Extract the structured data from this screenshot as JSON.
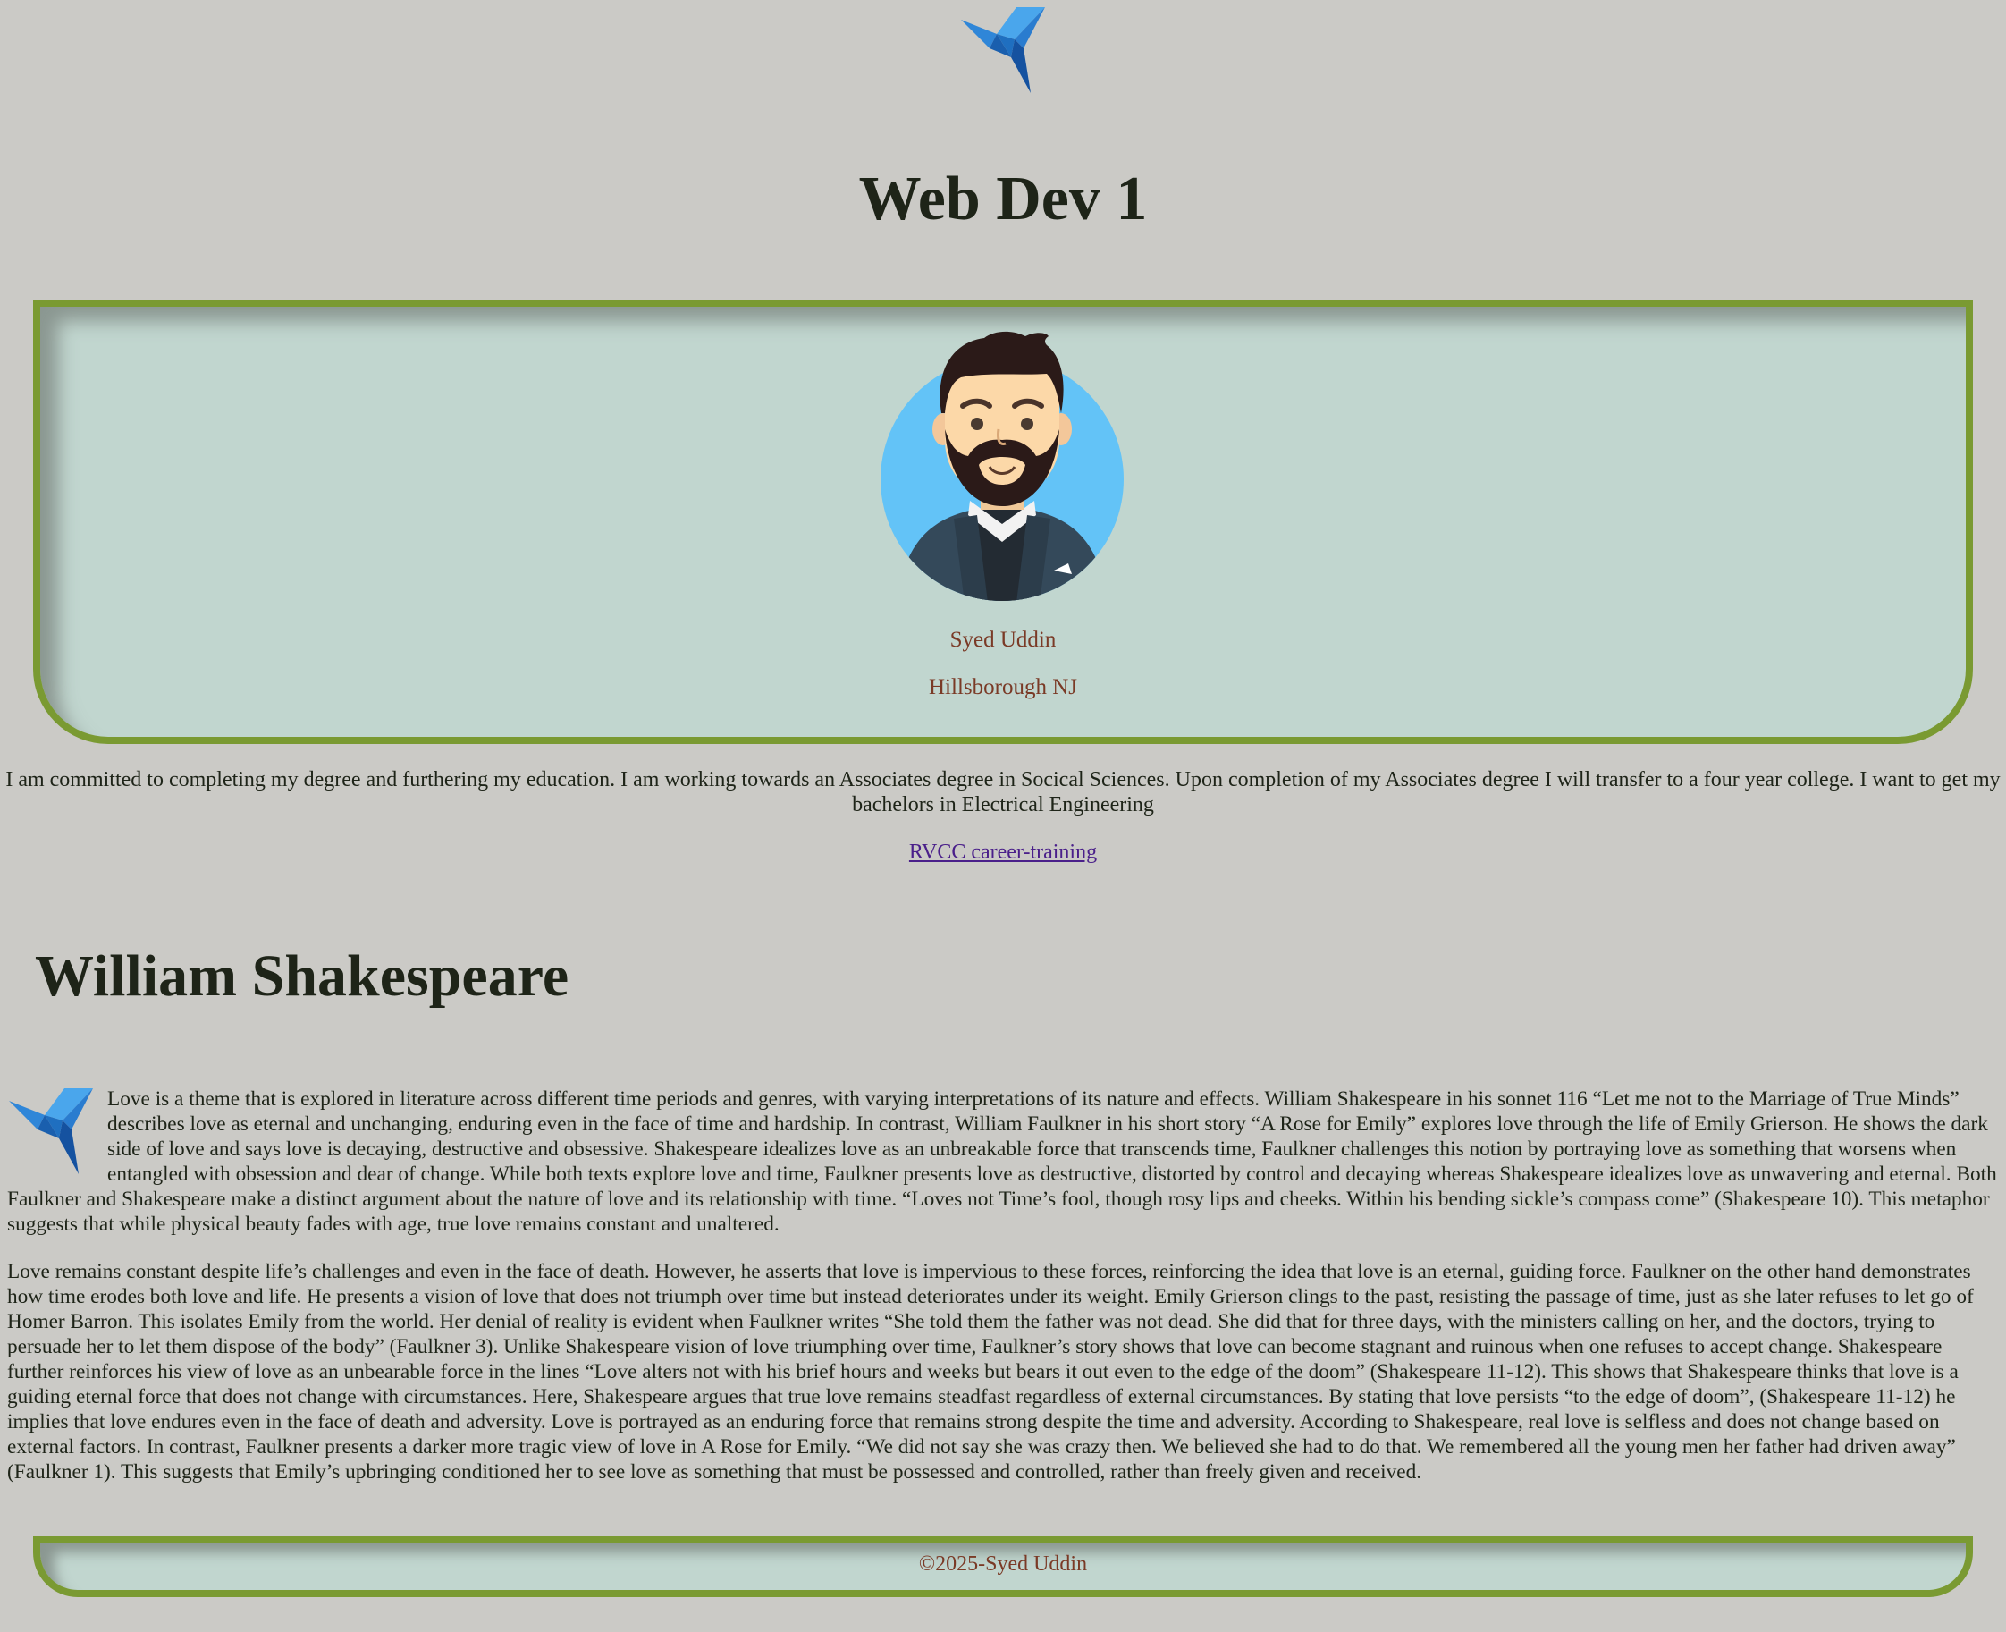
{
  "header": {
    "logo_icon": "origami-bird-icon",
    "title": "Web Dev 1"
  },
  "profile": {
    "avatar_icon": "bearded-man-avatar",
    "name": "Syed Uddin",
    "location": "Hillsborough NJ"
  },
  "intro": {
    "text": "I am committed to completing my degree and furthering my education. I am working towards an Associates degree in Socical Sciences. Upon completion of my Associates degree I will transfer to a four year college. I want to get my bachelors in Electrical Engineering",
    "link_label": "RVCC career-training"
  },
  "essay": {
    "title": "William Shakespeare",
    "paragraphs": [
      "Love is a theme that is explored in literature across different time periods and genres, with varying interpretations of its nature and effects. William Shakespeare in his sonnet 116 “Let me not to the Marriage of True Minds” describes love as eternal and unchanging, enduring even in the face of time and hardship. In contrast, William Faulkner in his short story “A Rose for Emily” explores love through the life of Emily Grierson. He shows the dark side of love and says love is decaying, destructive and obsessive. Shakespeare idealizes love as an unbreakable force that transcends time, Faulkner challenges this notion by portraying love as something that worsens when entangled with obsession and dear of change. While both texts explore love and time, Faulkner presents love as destructive, distorted by control and decaying whereas Shakespeare idealizes love as unwavering and eternal. Both Faulkner and Shakespeare make a distinct argument about the nature of love and its relationship with time. “Loves not Time’s fool, though rosy lips and cheeks. Within his bending sickle’s compass come” (Shakespeare 10). This metaphor suggests that while physical beauty fades with age, true love remains constant and unaltered.",
      "Love remains constant despite life’s challenges and even in the face of death. However, he asserts that love is impervious to these forces, reinforcing the idea that love is an eternal, guiding force. Faulkner on the other hand demonstrates how time erodes both love and life. He presents a vision of love that does not triumph over time but instead deteriorates under its weight. Emily Grierson clings to the past, resisting the passage of time, just as she later refuses to let go of Homer Barron. This isolates Emily from the world. Her denial of reality is evident when Faulkner writes “She told them the father was not dead. She did that for three days, with the ministers calling on her, and the doctors, trying to persuade her to let them dispose of the body” (Faulkner 3). Unlike Shakespeare vision of love triumphing over time, Faulkner’s story shows that love can become stagnant and ruinous when one refuses to accept change. Shakespeare further reinforces his view of love as an unbearable force in the lines “Love alters not with his brief hours and weeks but bears it out even to the edge of the doom” (Shakespeare 11-12). This shows that Shakespeare thinks that love is a guiding eternal force that does not change with circumstances. Here, Shakespeare argues that true love remains steadfast regardless of external circumstances. By stating that love persists “to the edge of doom”, (Shakespeare 11-12) he implies that love endures even in the face of death and adversity. Love is portrayed as an enduring force that remains strong despite the time and adversity. According to Shakespeare, real love is selfless and does not change based on external factors. In contrast, Faulkner presents a darker more tragic view of love in A Rose for Emily. “We did not say she was crazy then. We believed she had to do that. We remembered all the young men her father had driven away” (Faulkner 1). This suggests that Emily’s upbringing conditioned her to see love as something that must be possessed and controlled, rather than freely given and received."
    ]
  },
  "footer": {
    "text": "©2025-Syed Uddin"
  },
  "colors": {
    "page_background": "#cbcac6",
    "card_background": "#c1d6cf",
    "card_border": "#7a9a32",
    "accent_text": "#7a3a26",
    "link": "#4a1f8a"
  }
}
